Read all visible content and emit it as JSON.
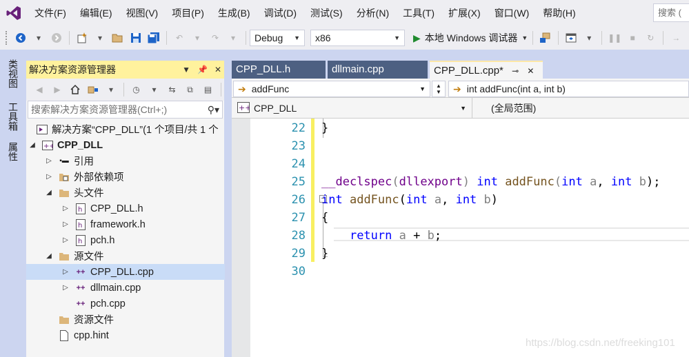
{
  "menu": [
    "文件(F)",
    "编辑(E)",
    "视图(V)",
    "项目(P)",
    "生成(B)",
    "调试(D)",
    "测试(S)",
    "分析(N)",
    "工具(T)",
    "扩展(X)",
    "窗口(W)",
    "帮助(H)"
  ],
  "menu_search_placeholder": "搜索 (",
  "toolbar": {
    "config": "Debug",
    "platform": "x86",
    "run_label": "本地 Windows 调试器"
  },
  "side_tabs": [
    "类视图",
    "工具箱",
    "属性"
  ],
  "solution_explorer": {
    "title": "解决方案资源管理器",
    "search_placeholder": "搜索解决方案资源管理器(Ctrl+;)",
    "tree": [
      {
        "label": "解决方案“CPP_DLL”(1 个项目/共 1 个",
        "icon": "solution-icon"
      },
      {
        "label": "CPP_DLL",
        "icon": "cpp-project-icon"
      },
      {
        "label": "引用",
        "icon": "references-icon"
      },
      {
        "label": "外部依赖项",
        "icon": "external-deps-icon"
      },
      {
        "label": "头文件",
        "icon": "filter-folder-icon"
      },
      {
        "label": "CPP_DLL.h",
        "icon": "header-file-icon"
      },
      {
        "label": "framework.h",
        "icon": "header-file-icon"
      },
      {
        "label": "pch.h",
        "icon": "header-file-icon"
      },
      {
        "label": "源文件",
        "icon": "filter-folder-icon"
      },
      {
        "label": "CPP_DLL.cpp",
        "icon": "cpp-file-icon"
      },
      {
        "label": "dllmain.cpp",
        "icon": "cpp-file-icon"
      },
      {
        "label": "pch.cpp",
        "icon": "cpp-file-icon"
      },
      {
        "label": "资源文件",
        "icon": "filter-folder-icon"
      },
      {
        "label": "cpp.hint",
        "icon": "text-file-icon"
      }
    ]
  },
  "tabs": [
    {
      "label": "CPP_DLL.h"
    },
    {
      "label": "dllmain.cpp"
    },
    {
      "label": "CPP_DLL.cpp*"
    }
  ],
  "nav": {
    "member": "addFunc",
    "signature": "int addFunc(int a, int b)",
    "project": "CPP_DLL",
    "scope": "(全局范围)"
  },
  "editor": {
    "line_numbers": [
      "22",
      "23",
      "24",
      "25",
      "26",
      "27",
      "28",
      "29",
      "30"
    ]
  },
  "watermark": "https://blog.csdn.net/freeking101",
  "colors": {
    "accent": "#68217a",
    "tab_active_border": "#ffe8a6",
    "change_bar": "#f8ef61"
  }
}
